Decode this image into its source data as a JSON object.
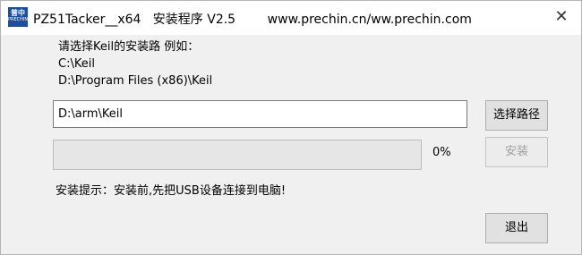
{
  "window": {
    "title": "PZ51Tacker__x64   安装程序 V2.5        www.prechin.cn/ww.prechin.com",
    "icon_name": "prechin-logo-icon",
    "icon_text": "普中",
    "icon_subtext": "PRECHIN",
    "close_glyph": "✕"
  },
  "instructions": {
    "line1": "请选择Keil的安装路 例如：",
    "line2": "C:\\Keil",
    "line3": "D:\\Program Files (x86)\\Keil"
  },
  "install_path": {
    "value": "D:\\arm\\Keil"
  },
  "buttons": {
    "browse": "选择路径",
    "install": "安装",
    "exit": "退出"
  },
  "progress": {
    "value": 0,
    "label": "0%"
  },
  "status_text": "安装提示：安装前,先把USB设备连接到电脑!",
  "colors": {
    "progress_fill": "#06b025",
    "icon_bg": "#1c4fa0"
  }
}
